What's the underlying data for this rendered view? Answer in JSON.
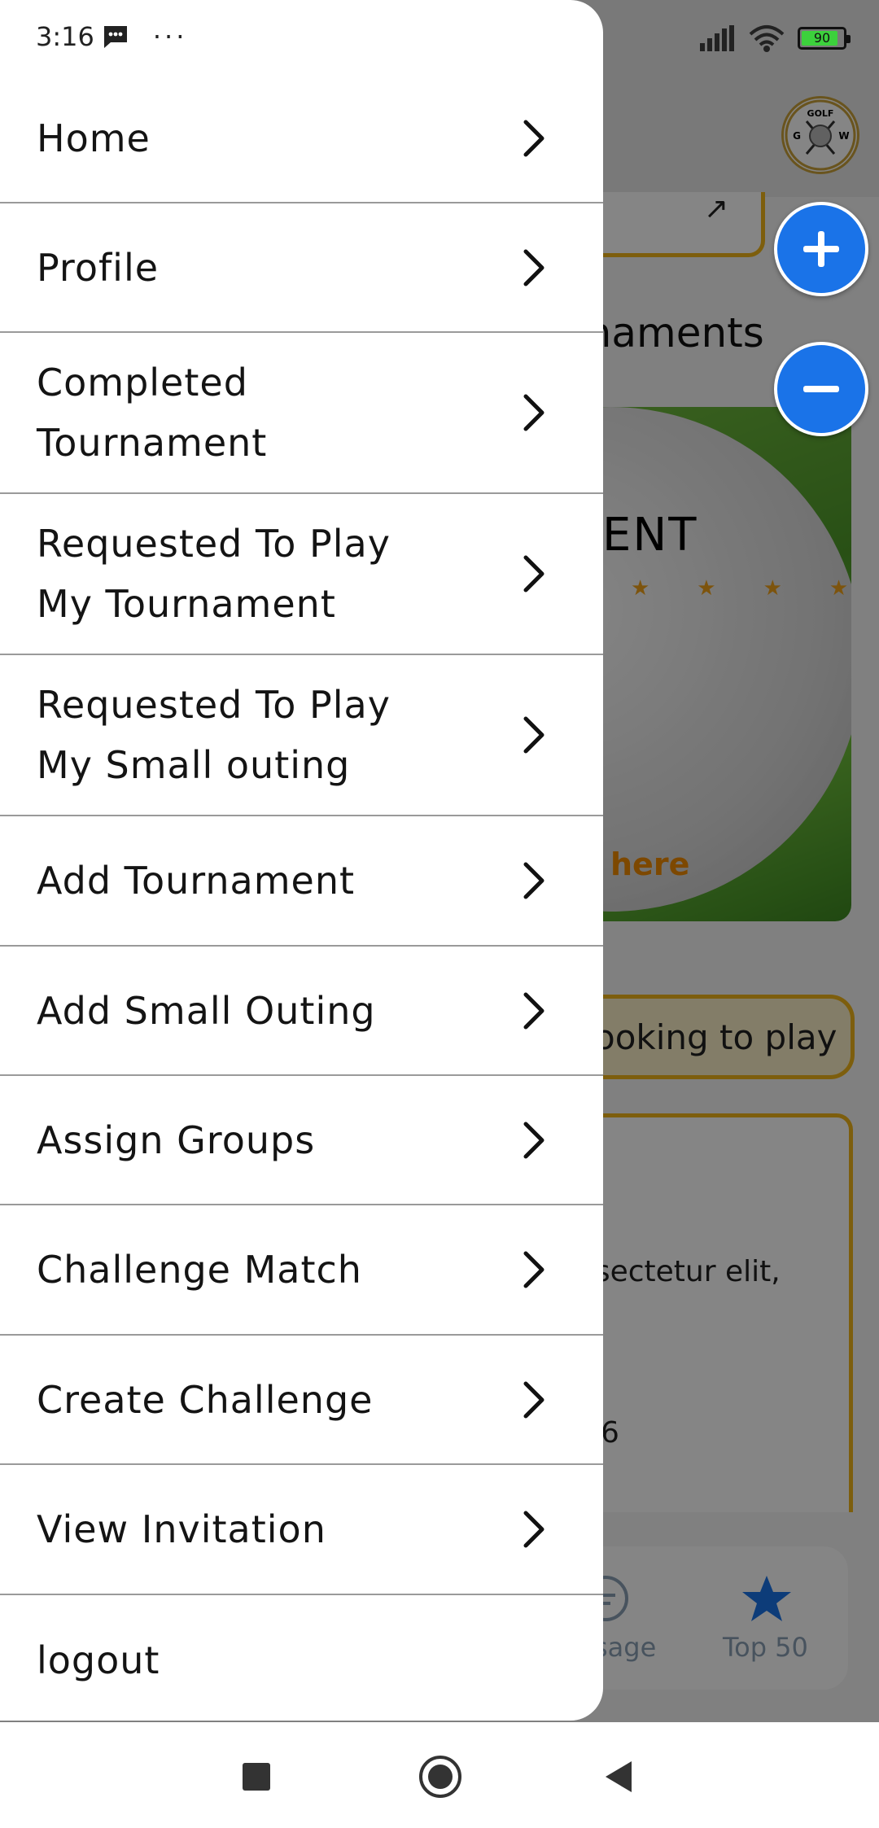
{
  "status_bar": {
    "time": "3:16",
    "more": "···",
    "battery": "90"
  },
  "background": {
    "logo_top": "GOLF",
    "logo_left": "G",
    "logo_right": "W",
    "tournaments_heading": "rnaments",
    "card_title": "ENT",
    "stars": "★★★★",
    "card_link": "here",
    "looking_button": "ooking to play",
    "lorem": "nsectetur elit,",
    "number": "6",
    "tab_message": "sage",
    "tab_top50": "Top 50"
  },
  "drawer": {
    "items": [
      {
        "label": "Home"
      },
      {
        "label": "Profile"
      },
      {
        "label": "Completed\nTournament"
      },
      {
        "label": "Requested To Play\nMy Tournament"
      },
      {
        "label": "Requested To Play\nMy Small outing"
      },
      {
        "label": "Add Tournament"
      },
      {
        "label": "Add Small Outing"
      },
      {
        "label": "Assign Groups"
      },
      {
        "label": "Challenge Match"
      },
      {
        "label": "Create Challenge"
      },
      {
        "label": "View Invitation"
      },
      {
        "label": "logout"
      }
    ]
  },
  "zoom": {
    "plus": "+",
    "minus": "−"
  },
  "colors": {
    "accent_blue": "#1a73e8",
    "gold_border": "#f0b51a",
    "drawer_bg": "#ffffff",
    "divider": "#9a9a9a"
  }
}
